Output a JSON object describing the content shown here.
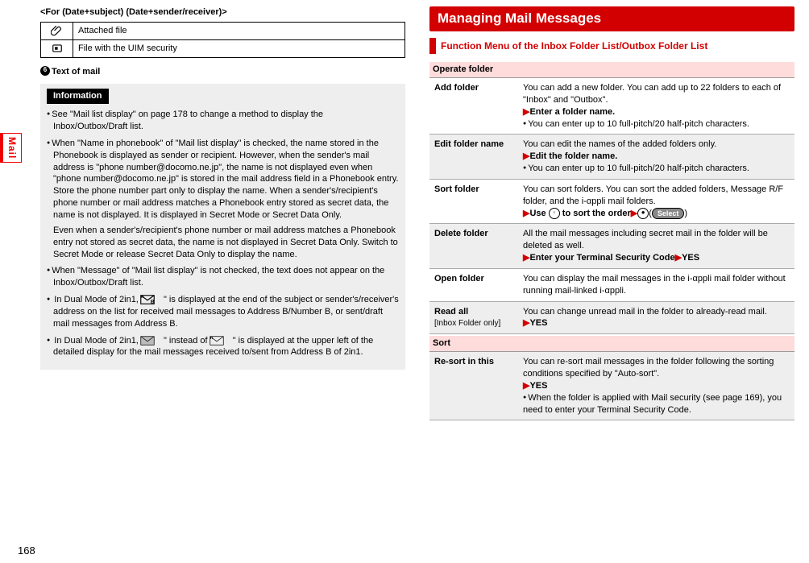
{
  "sideTab": "Mail",
  "forLine": "<For (Date+subject) (Date+sender/receiver)>",
  "iconTable": {
    "row1": "Attached file",
    "row2": "File with the UIM security"
  },
  "textOfMail": {
    "num": "6",
    "label": "Text of mail"
  },
  "information": {
    "title": "Information",
    "bullets": {
      "b1": "See \"Mail list display\" on page 178 to change a method to display the Inbox/Outbox/Draft list.",
      "b2": "When \"Name in phonebook\" of \"Mail list display\" is checked, the name stored in the Phonebook is displayed as sender or recipient. However, when the sender's mail address is \"phone number@docomo.ne.jp\", the name is not displayed even when \"phone number@docomo.ne.jp\" is stored in the mail address field in a Phonebook entry. Store the phone number part only to display the name. When a sender's/recipient's phone number or mail address matches a Phonebook entry stored as secret data, the name is not displayed. It is displayed in Secret Mode or Secret Data Only.",
      "b2b": "Even when a sender's/recipient's phone number or mail address matches a Phonebook entry not stored as secret data, the name is not displayed in Secret Data Only. Switch to Secret Mode or release Secret Data Only to display the name.",
      "b3": "When \"Message\" of \"Mail list display\" is not checked, the text does not appear on the Inbox/Outbox/Draft list.",
      "b4a": "In Dual Mode of 2in1, \" ",
      "b4b": " \" is displayed at the end of the subject or sender's/receiver's address on the list for received mail messages to Address B/Number B, or sent/draft mail messages from Address B.",
      "b5a": "In Dual Mode of 2in1, \" ",
      "b5b": " \" instead of \" ",
      "b5c": " \" is displayed at the upper left of the detailed display for the mail messages received to/sent from Address B of 2in1."
    }
  },
  "right": {
    "heading": "Managing Mail Messages",
    "subheading": "Function Menu of the Inbox Folder List/Outbox Folder List",
    "cat1": "Operate folder",
    "addFolder": {
      "label": "Add folder",
      "line1": "You can add a new folder. You can add up to 22 folders to each of \"Inbox\" and \"Outbox\".",
      "line2": "Enter a folder name.",
      "line3": "You can enter up to 10 full-pitch/20 half-pitch characters."
    },
    "editFolder": {
      "label": "Edit folder name",
      "line1": "You can edit the names of the added folders only.",
      "line2": "Edit the folder name.",
      "line3": "You can enter up to 10 full-pitch/20 half-pitch characters."
    },
    "sortFolder": {
      "label": "Sort folder",
      "line1": "You can sort folders. You can sort the added folders, Message R/F folder, and the i-αppli mail folders.",
      "line2a": "Use ",
      "line2b": " to sort the order",
      "selectLabel": "Select"
    },
    "deleteFolder": {
      "label": "Delete folder",
      "line1": "All the mail messages including secret mail in the folder will be deleted as well.",
      "line2": "Enter your Terminal Security Code",
      "yes": "YES"
    },
    "openFolder": {
      "label": "Open folder",
      "line1": "You can display the mail messages in the i-αppli mail folder without running mail-linked i-αppli."
    },
    "readAll": {
      "label": "Read all",
      "sub": "[Inbox Folder only]",
      "line1": "You can change unread mail in the folder to already-read mail.",
      "yes": "YES"
    },
    "cat2": "Sort",
    "resort": {
      "label": "Re-sort in this",
      "line1": "You can re-sort mail messages in the folder following the sorting conditions specified by \"Auto-sort\".",
      "yes": "YES",
      "line2": "When the folder is applied with Mail security (see page 169), you need to enter your Terminal Security Code."
    }
  },
  "pageNum": "168"
}
